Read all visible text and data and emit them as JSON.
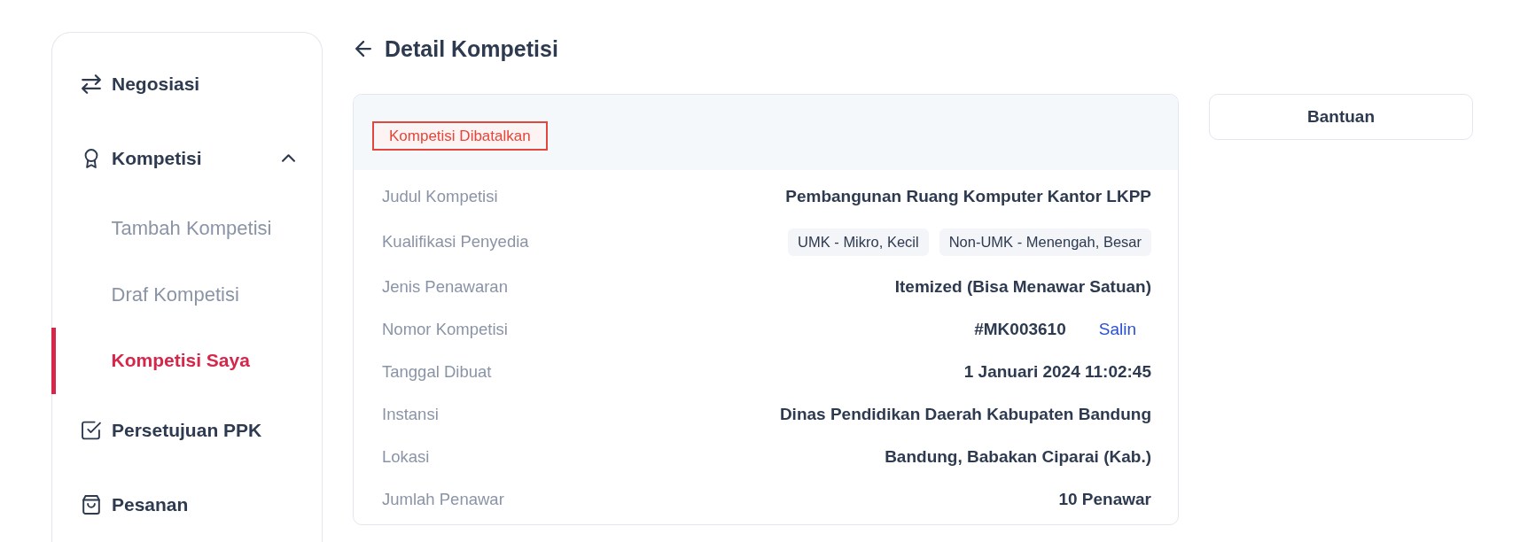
{
  "sidebar": {
    "items": [
      {
        "label": "Negosiasi",
        "selected": false
      },
      {
        "label": "Kompetisi",
        "selected": false,
        "expanded": true,
        "children": [
          {
            "label": "Tambah Kompetisi",
            "selected": false
          },
          {
            "label": "Draf Kompetisi",
            "selected": false
          },
          {
            "label": "Kompetisi Saya",
            "selected": true
          }
        ]
      },
      {
        "label": "Persetujuan PPK",
        "selected": false
      },
      {
        "label": "Pesanan",
        "selected": false
      }
    ]
  },
  "page": {
    "title": "Detail Kompetisi"
  },
  "detail_card": {
    "status": {
      "label": "Kompetisi Dibatalkan",
      "highlighted": true
    },
    "rows": [
      {
        "kind": "text",
        "label": "Judul Kompetisi",
        "value": "Pembangunan Ruang Komputer Kantor LKPP"
      },
      {
        "kind": "tags",
        "label": "Kualifikasi Penyedia",
        "tags": [
          "UMK - Mikro, Kecil",
          "Non-UMK - Menengah, Besar"
        ]
      },
      {
        "kind": "text",
        "label": "Jenis Penawaran",
        "value": "Itemized (Bisa Menawar Satuan)"
      },
      {
        "kind": "copy",
        "label": "Nomor Kompetisi",
        "value": "#MK003610",
        "action": "Salin"
      },
      {
        "kind": "text",
        "label": "Tanggal Dibuat",
        "value": "1 Januari 2024 11:02:45"
      },
      {
        "kind": "text",
        "label": "Instansi",
        "value": "Dinas Pendidikan Daerah Kabupaten Bandung"
      },
      {
        "kind": "text",
        "label": "Lokasi",
        "value": "Bandung, Babakan Ciparai (Kab.)"
      },
      {
        "kind": "text",
        "label": "Jumlah Penawar",
        "value": "10 Penawar"
      }
    ]
  },
  "help_button": {
    "label": "Bantuan"
  }
}
